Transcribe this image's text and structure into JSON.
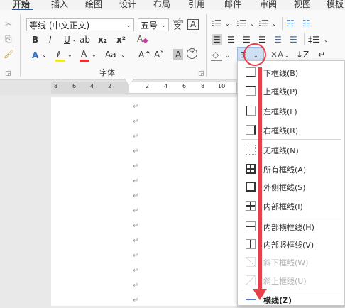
{
  "tabs": [
    "开始",
    "插入",
    "绘图",
    "设计",
    "布局",
    "引用",
    "邮件",
    "审阅",
    "视图",
    "模板"
  ],
  "font": {
    "name": "等线 (中文正文)",
    "size": "五号",
    "phonetic": "wén",
    "phonetic_char": "文",
    "border_char": "A",
    "bold": "B",
    "italic": "I",
    "underline": "U",
    "strike": "ab",
    "subscript": "x₂",
    "superscript": "x²",
    "clear": "A",
    "effects": "A",
    "highlight": "ℓ",
    "color": "A",
    "change_case": "Aa",
    "grow": "A^",
    "shrink": "Aˇ",
    "shade": "A",
    "enclose": "字",
    "group_label": "字体"
  },
  "clipboard": {
    "cut": "✂",
    "copy": "⎘",
    "painter": "🖌"
  },
  "paragraph_tools": [
    "☰",
    "☰",
    "☰",
    "☰",
    "☰"
  ],
  "ruler": {
    "ticks": [
      "8",
      "6",
      "4",
      "2",
      "2",
      "4",
      "6",
      "8",
      "10"
    ]
  },
  "para_mark": "↵",
  "menu": {
    "items": [
      {
        "label": "下框线(B)",
        "icon": "bottom-border-icon",
        "disabled": false
      },
      {
        "label": "上框线(P)",
        "icon": "top-border-icon",
        "disabled": false
      },
      {
        "label": "左框线(L)",
        "icon": "left-border-icon",
        "disabled": false
      },
      {
        "label": "右框线(R)",
        "icon": "right-border-icon",
        "disabled": false
      },
      {
        "label": "无框线(N)",
        "icon": "no-border-icon",
        "disabled": false
      },
      {
        "label": "所有框线(A)",
        "icon": "all-borders-icon",
        "disabled": false
      },
      {
        "label": "外侧框线(S)",
        "icon": "outside-borders-icon",
        "disabled": false
      },
      {
        "label": "内部框线(I)",
        "icon": "inside-borders-icon",
        "disabled": false
      },
      {
        "label": "内部横框线(H)",
        "icon": "inside-horizontal-border-icon",
        "disabled": false
      },
      {
        "label": "内部竖框线(V)",
        "icon": "inside-vertical-border-icon",
        "disabled": false
      },
      {
        "label": "斜下框线(W)",
        "icon": "diagonal-down-border-icon",
        "disabled": true
      },
      {
        "label": "斜上框线(U)",
        "icon": "diagonal-up-border-icon",
        "disabled": true
      },
      {
        "label": "横线(Z)",
        "icon": "horizontal-line-icon",
        "disabled": false
      }
    ]
  },
  "colors": {
    "accent": "#2b579a",
    "highlight_red": "#e8404a"
  }
}
